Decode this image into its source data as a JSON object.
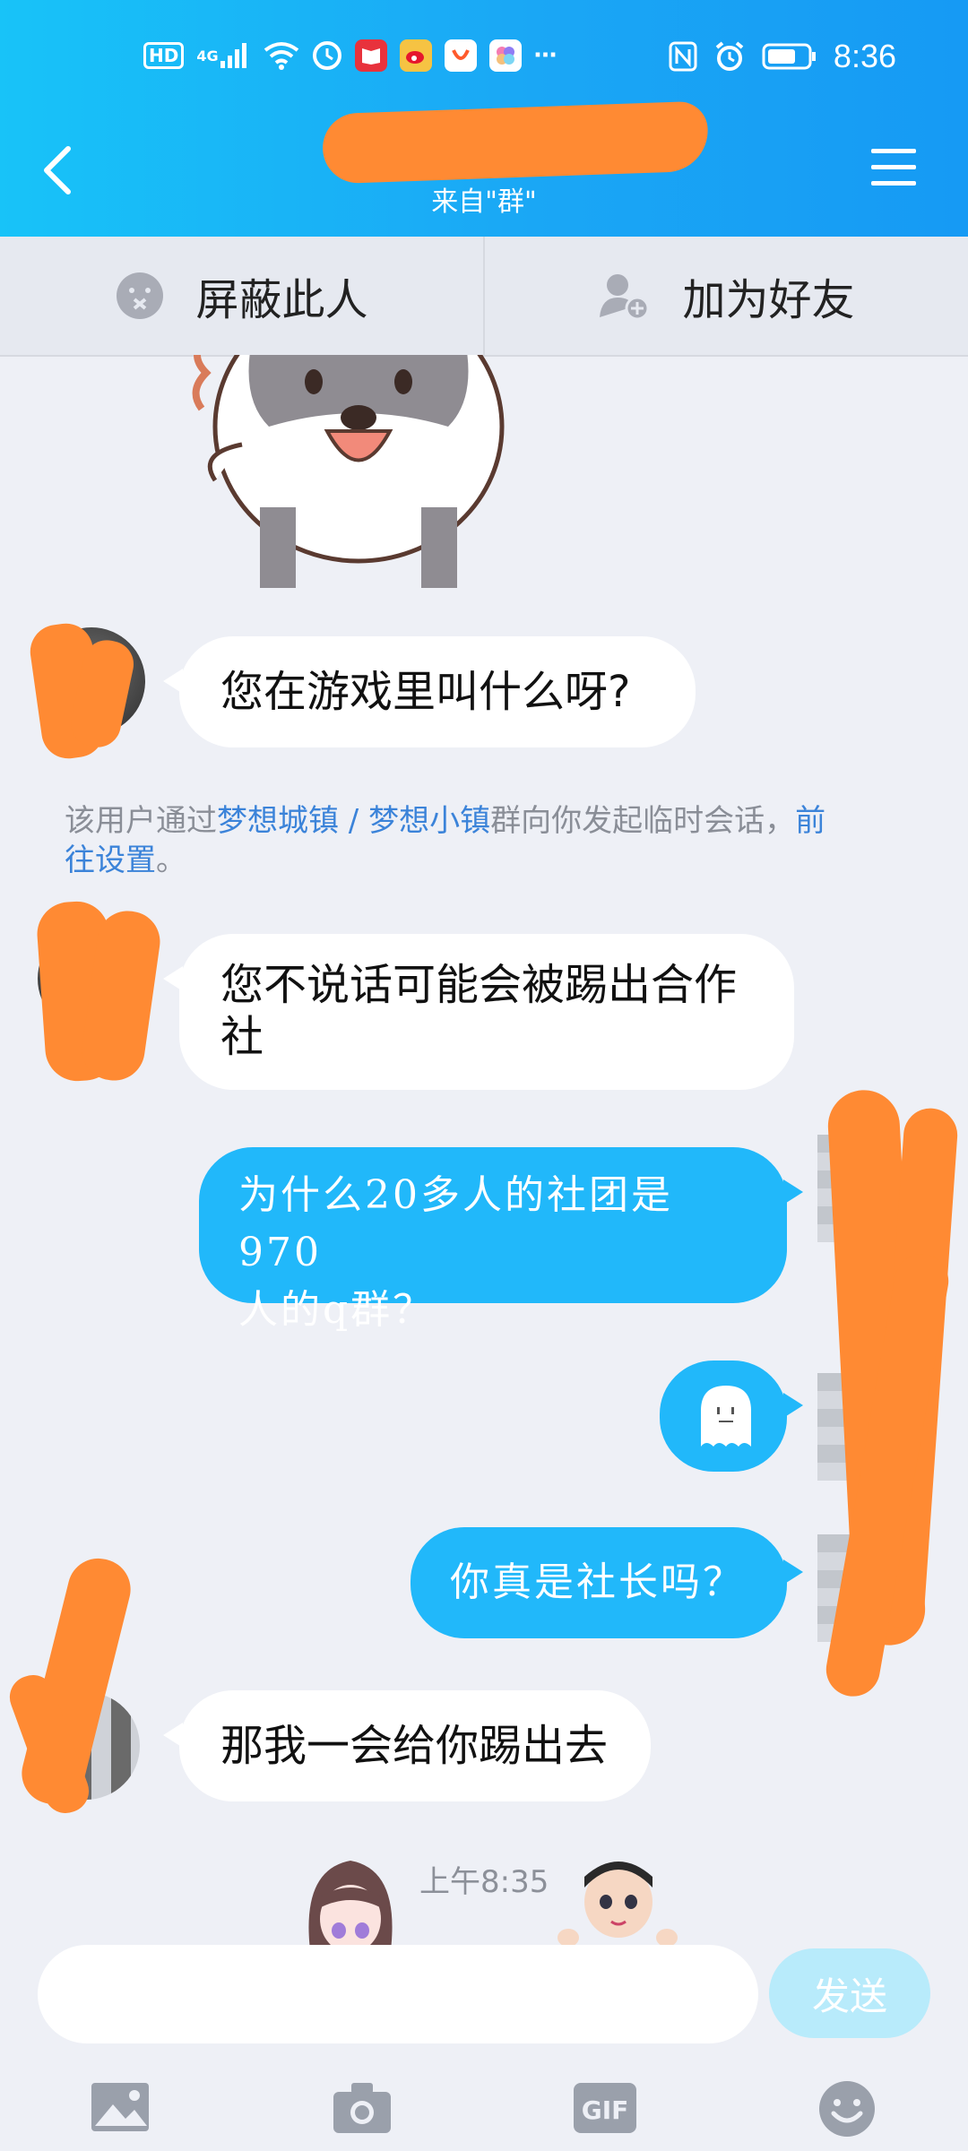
{
  "status_bar": {
    "hd": "HD",
    "network": "4G",
    "time": "8:36"
  },
  "header": {
    "subtitle": "来自\"群\"",
    "accent": "#1aa7f5"
  },
  "actions": {
    "block_label": "屏蔽此人",
    "add_friend_label": "加为好友"
  },
  "messages": [
    {
      "side": "in",
      "text": "您在游戏里叫什么呀?"
    },
    {
      "side": "in",
      "text_line1": "您不说话可能会被踢出合作",
      "text_line2": "社"
    },
    {
      "side": "out",
      "text_line1": "为什么20多人的社团是970",
      "text_line2": "人的q群？"
    },
    {
      "side": "out",
      "sticker": "ghost-sticker"
    },
    {
      "side": "out",
      "text": "你真是社长吗？"
    },
    {
      "side": "in",
      "text": "那我一会给你踢出去"
    }
  ],
  "system_note": {
    "prefix": "该用户通过",
    "group_link": "梦想城镇 / 梦想小镇",
    "middle": "群向你发起临时会话，",
    "settings_link_part1": "前",
    "settings_link_part2": "往设置",
    "suffix": "。"
  },
  "timestamp": "上午8:35",
  "composer": {
    "input_value": "",
    "send_label": "发送"
  },
  "toolbar": {
    "icons": [
      "image-icon",
      "camera-icon",
      "gif-icon",
      "emoji-icon"
    ],
    "gif_label": "GIF"
  }
}
